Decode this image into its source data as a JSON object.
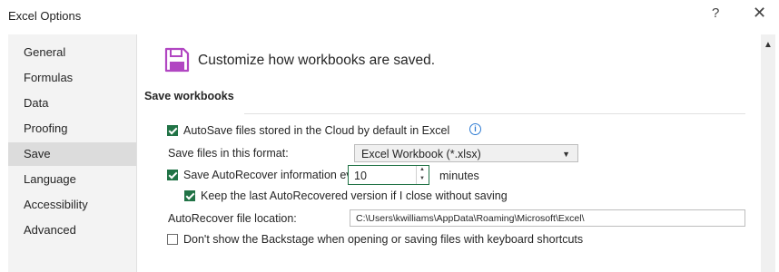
{
  "window": {
    "title": "Excel Options",
    "help_label": "?",
    "close_label": "✕"
  },
  "sidebar": {
    "items": [
      {
        "label": "General"
      },
      {
        "label": "Formulas"
      },
      {
        "label": "Data"
      },
      {
        "label": "Proofing"
      },
      {
        "label": "Save",
        "active": true
      },
      {
        "label": "Language"
      },
      {
        "label": "Accessibility"
      },
      {
        "label": "Advanced"
      }
    ]
  },
  "main": {
    "heading": "Customize how workbooks are saved.",
    "section_title": "Save workbooks",
    "autosave": {
      "label": "AutoSave files stored in the Cloud by default in Excel",
      "checked": true
    },
    "format": {
      "label": "Save files in this format:",
      "value": "Excel Workbook (*.xlsx)"
    },
    "autorecover": {
      "label": "Save AutoRecover information every",
      "value": "10",
      "unit": "minutes",
      "checked": true
    },
    "keep_last": {
      "label": "Keep the last AutoRecovered version if I close without saving",
      "checked": true
    },
    "location": {
      "label": "AutoRecover file location:",
      "value": "C:\\Users\\kwilliams\\AppData\\Roaming\\Microsoft\\Excel\\"
    },
    "backstage": {
      "label": "Don't show the Backstage when opening or saving files with keyboard shortcuts",
      "checked": false
    }
  },
  "icons": {
    "floppy": "save-floppy-icon",
    "info": "info-icon",
    "dropdown": "chevron-down-icon"
  },
  "colors": {
    "accent": "#217346",
    "floppy": "#b146c2",
    "info": "#2f7cd3"
  }
}
